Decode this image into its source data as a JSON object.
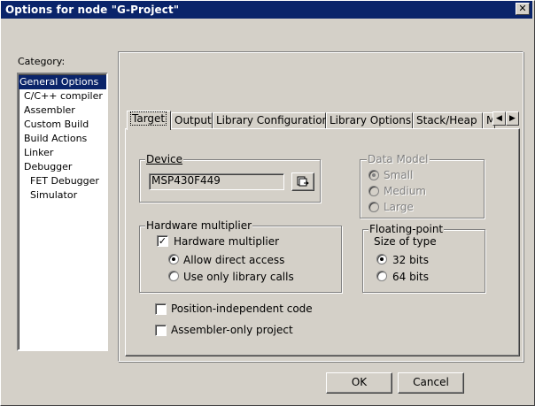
{
  "window": {
    "title": "Options for node \"G-Project\"",
    "close_glyph": "✕"
  },
  "category": {
    "label": "Category:",
    "items": [
      {
        "label": "General Options",
        "selected": true
      },
      {
        "label": "C/C++ compiler"
      },
      {
        "label": "Assembler"
      },
      {
        "label": "Custom Build"
      },
      {
        "label": "Build Actions"
      },
      {
        "label": "Linker"
      },
      {
        "label": "Debugger"
      },
      {
        "label": "FET Debugger"
      },
      {
        "label": "Simulator"
      }
    ]
  },
  "tabs": [
    "Target",
    "Output",
    "Library Configuration",
    "Library Options",
    "Stack/Heap",
    "M"
  ],
  "tab_scroll": {
    "left": "◀",
    "right": "▶"
  },
  "device": {
    "group_title": "Device",
    "value": "MSP430F449",
    "browse_icon": "device-select-icon"
  },
  "data_model": {
    "group_title": "Data Model",
    "options": [
      "Small",
      "Medium",
      "Large"
    ],
    "selected": "Small"
  },
  "hardware_multiplier": {
    "group_title": "Hardware multiplier",
    "checkbox_label": "Hardware multiplier",
    "checked": true,
    "options": [
      "Allow direct access",
      "Use only library calls"
    ],
    "selected": "Allow direct access"
  },
  "floating_point": {
    "group_title": "Floating-point",
    "size_label": "Size of type",
    "options": [
      "32 bits",
      "64 bits"
    ],
    "selected": "32 bits"
  },
  "position_independent": {
    "label": "Position-independent code",
    "checked": false
  },
  "assembler_only": {
    "label": "Assembler-only project",
    "checked": false
  },
  "buttons": {
    "ok": "OK",
    "cancel": "Cancel"
  },
  "colors": {
    "titlebar": "#0a246a",
    "face": "#d4d0c8",
    "selection": "#0a246a"
  }
}
